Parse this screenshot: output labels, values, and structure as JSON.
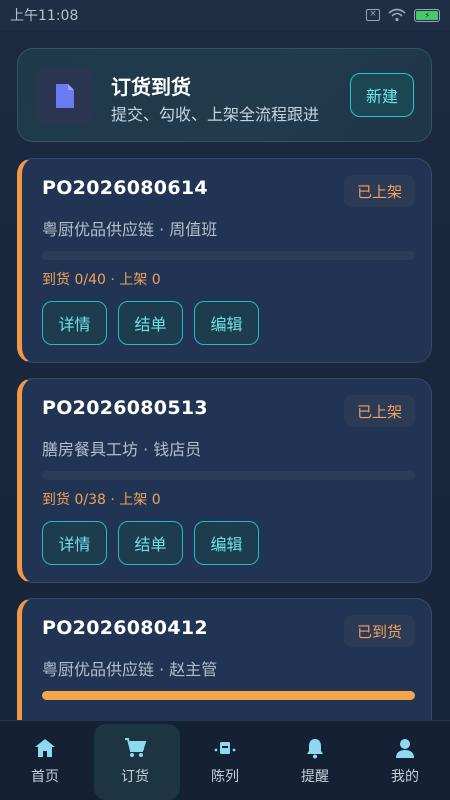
{
  "status_bar": {
    "time": "上午11:08",
    "battery_symbol": "⚡"
  },
  "hero": {
    "title": "订货到货",
    "subtitle": "提交、勾收、上架全流程跟进",
    "new_button": "新建"
  },
  "orders": [
    {
      "po": "PO2026080614",
      "status": "已上架",
      "supplier": "粤厨优品供应链 · 周值班",
      "meta": "到货 0/40 · 上架 0",
      "progress": 0
    },
    {
      "po": "PO2026080513",
      "status": "已上架",
      "supplier": "膳房餐具工坊 · 钱店员",
      "meta": "到货 0/38 · 上架 0",
      "progress": 0
    },
    {
      "po": "PO2026080412",
      "status": "已到货",
      "supplier": "粤厨优品供应链 · 赵主管",
      "meta": "",
      "progress": 1.0
    }
  ],
  "actions": {
    "detail": "详情",
    "settle": "结单",
    "edit": "编辑"
  },
  "tabs": [
    {
      "label": "首页",
      "icon": "home-icon"
    },
    {
      "label": "订货",
      "icon": "cart-icon"
    },
    {
      "label": "陈列",
      "icon": "display-icon"
    },
    {
      "label": "提醒",
      "icon": "bell-icon"
    },
    {
      "label": "我的",
      "icon": "user-icon"
    }
  ],
  "colors": {
    "accent": "#29c4cc",
    "orange": "#f19844",
    "background": "#1b2a40"
  }
}
